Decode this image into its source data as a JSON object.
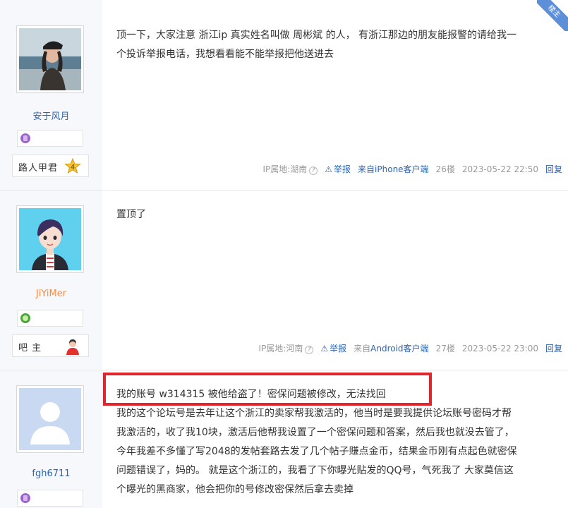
{
  "posts": [
    {
      "username": "安于风月",
      "corner_badge": "楼主",
      "rank_title": "路人甲君",
      "rank_level": "4",
      "content_lines": [
        "顶一下，大家注意 浙江ip 真实姓名叫做 周彬斌 的人，  有浙江那边的朋友能报警的请给我一",
        "个投诉举报电话，我想看看能不能举报把他送进去"
      ],
      "ip": "IP属地:湖南",
      "report": "举报",
      "client": "来自iPhone客户端",
      "floor": "26楼",
      "time": "2023-05-22 22:50",
      "reply": "回复"
    },
    {
      "username": "JiYiMer",
      "rank_title": "吧 主",
      "content_lines": [
        "置顶了"
      ],
      "ip": "IP属地:河南",
      "report": "举报",
      "client": "来自Android客户端",
      "floor": "27楼",
      "time": "2023-05-22 23:00",
      "reply": "回复"
    },
    {
      "username": "fgh6711",
      "content_lines": [
        "我的账号 w314315 被他给盗了！密保问题被修改，无法找回",
        "我的这个论坛号是去年让这个浙江的卖家帮我激活的，他当时是要我提供论坛账号密码才帮",
        "我激活的，收了我10块，激活后他帮我设置了一个密保问题和答案，然后我也就没去管了，",
        "今年我差不多懂了写2048的发帖套路去发了几个帖子赚点金币，结果金币刚有点起色就密保",
        "问题错误了，妈的。 就是这个浙江的，我看了下你曝光贴发的QQ号，气死我了 大家莫信这",
        "个曝光的黑商家，他会把你的号修改密保然后拿去卖掉"
      ]
    }
  ],
  "colors": {
    "link_blue": "#2d64b3",
    "highlight_red": "#e0262c",
    "sidebar_bg": "#f6f8fc"
  }
}
